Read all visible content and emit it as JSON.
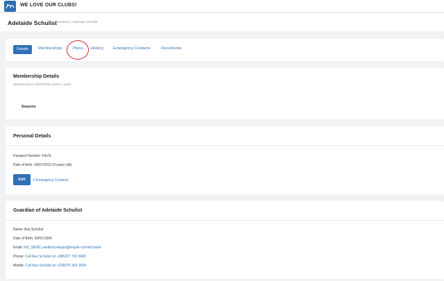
{
  "app": {
    "title": "WE LOVE OUR CLUBS!"
  },
  "page": {
    "title": "Adelaide Schulist",
    "breadcrumb": "Members  |  Adelaide Schulist"
  },
  "tabs": [
    {
      "label": "Details",
      "active": true
    },
    {
      "label": "Memberships"
    },
    {
      "label": "Plans"
    },
    {
      "label": "History"
    },
    {
      "label": "Emergency Contacts"
    },
    {
      "label": "Documents"
    }
  ],
  "membership": {
    "title": "Membership Details",
    "since": "Member since 11/02/2021 (over 1 year)",
    "seasons_label": "Seasons"
  },
  "personal": {
    "title": "Personal Details",
    "passport": "Passport Number: fvfo7k",
    "dob": "Date of birth: 24/07/2013 (9 years old)",
    "edit_label": "Edit",
    "emergency_link": "0 Emergency Contacts"
  },
  "guardian": {
    "title": "Guardian of Adelaide Schulist",
    "name": "Name: Asa Schulist",
    "dob": "Date of Birth: 03/01/1994",
    "email_label": "Email:",
    "email_value": "NO_SEND_winifred.reinger@krajcik-schmitt.name",
    "phone_label": "Phone:",
    "phone_value": "Call Asa Schulist on +386227 732 9968",
    "mobile_label": "Mobile:",
    "mobile_value": "Call Asa Schulist on +239275 363 3034"
  },
  "colors": {
    "accent": "#2e6fb6",
    "annotation": "#d9202a"
  }
}
